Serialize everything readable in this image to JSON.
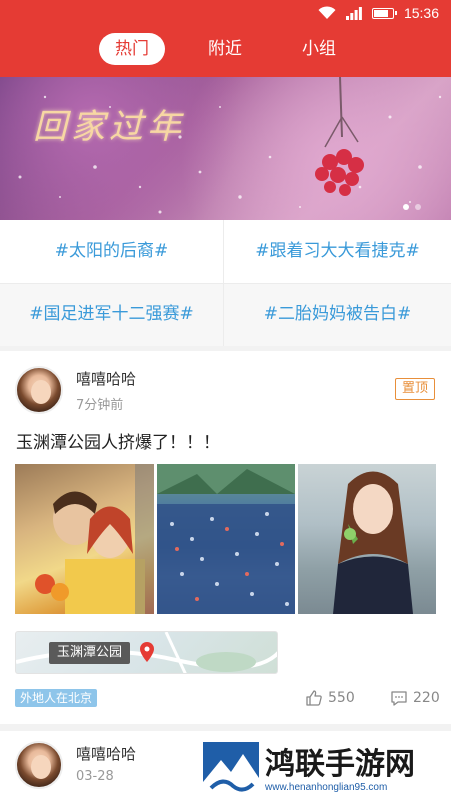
{
  "status_bar": {
    "time": "15:36"
  },
  "tabs": [
    {
      "label": "热门",
      "active": true
    },
    {
      "label": "附近",
      "active": false
    },
    {
      "label": "小组",
      "active": false
    }
  ],
  "banner": {
    "title": "回家过年"
  },
  "topics": [
    "#太阳的后裔#",
    "#跟着习大大看捷克#",
    "#国足进军十二强赛#",
    "#二胎妈妈被告白#"
  ],
  "posts": [
    {
      "username": "嘻嘻哈哈",
      "time": "7分钟前",
      "badge": "置顶",
      "text": "玉渊潭公园人挤爆了！！！",
      "location": "玉渊潭公园",
      "tag": "外地人在北京",
      "likes": "550",
      "comments": "220"
    },
    {
      "username": "嘻嘻哈哈",
      "time": "03-28"
    }
  ],
  "watermark": {
    "title": "鸿联手游网",
    "url": "www.henanhonglian95.com"
  },
  "colors": {
    "header": "#e53b34",
    "topic_text": "#3a9ad9",
    "badge": "#e88f3a"
  }
}
